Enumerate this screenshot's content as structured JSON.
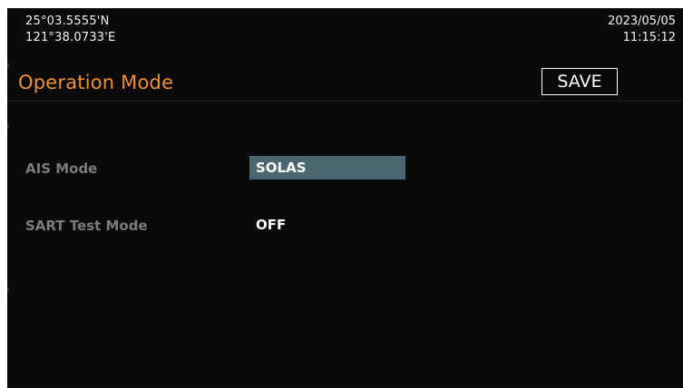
{
  "status": {
    "latitude": "25°03.5555'N",
    "longitude": "121°38.0733'E",
    "date": "2023/05/05",
    "time": "11:15:12"
  },
  "header": {
    "title": "Operation Mode",
    "save_label": "SAVE"
  },
  "settings": [
    {
      "label": "AIS Mode",
      "value": "SOLAS",
      "selected": true
    },
    {
      "label": "SART Test Mode",
      "value": "OFF",
      "selected": false
    }
  ],
  "colors": {
    "background": "#0a0a0a",
    "title": "#ef8f2c",
    "label": "#7b7b7b",
    "selection": "#4a6670"
  }
}
